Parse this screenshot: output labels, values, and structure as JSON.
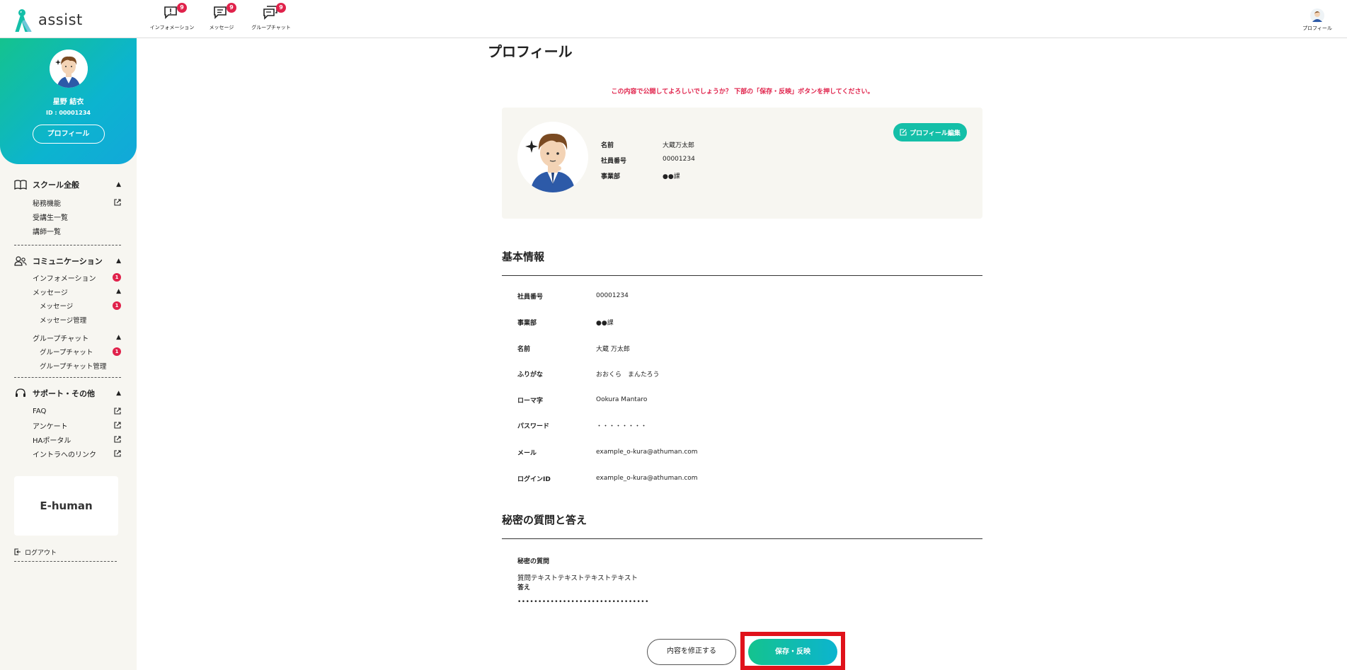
{
  "header": {
    "logo_text": "assist",
    "nav": [
      {
        "label": "インフォメーション",
        "badge": "9",
        "icon": "info-bubble-icon"
      },
      {
        "label": "メッセージ",
        "badge": "9",
        "icon": "message-bubble-icon"
      },
      {
        "label": "グループチャット",
        "badge": "9",
        "icon": "group-chat-icon"
      }
    ],
    "profile_label": "プロフィール"
  },
  "sidebar": {
    "user_name": "星野 結衣",
    "user_id": "ID : 00001234",
    "profile_button": "プロフィール",
    "sections": {
      "school": {
        "title": "スクール全般",
        "items": [
          "秘務機能",
          "受講生一覧",
          "講師一覧"
        ]
      },
      "communication": {
        "title": "コミュニケーション",
        "info": {
          "label": "インフォメーション",
          "badge": "1"
        },
        "message_group": "メッセージ",
        "message": {
          "label": "メッセージ",
          "badge": "1"
        },
        "message_manage": "メッセージ管理",
        "group_chat_group": "グループチャット",
        "group_chat": {
          "label": "グループチャット",
          "badge": "1"
        },
        "group_chat_manage": "グループチャット管理"
      },
      "support": {
        "title": "サポート・その他",
        "items": [
          "FAQ",
          "アンケート",
          "HAポータル",
          "イントラへのリンク"
        ]
      }
    },
    "banner": "E-human",
    "logout": "ログアウト"
  },
  "main": {
    "title": "プロフィール",
    "notice": "この内容で公開してよろしいでしょうか？ 下部の「保存・反映」ボタンを押してください。",
    "card": {
      "edit_button": "プロフィール編集",
      "rows": [
        {
          "label": "名前",
          "value": "大蔵万太郎"
        },
        {
          "label": "社員番号",
          "value": "00001234"
        },
        {
          "label": "事業部",
          "value": "●●課"
        }
      ]
    },
    "basic_title": "基本情報",
    "basic_rows": [
      {
        "label": "社員番号",
        "value": "00001234"
      },
      {
        "label": "事業部",
        "value": "●●課"
      },
      {
        "label": "名前",
        "value": "大蔵 万太郎"
      },
      {
        "label": "ふりがな",
        "value": "おおくら　まんたろう"
      },
      {
        "label": "ローマ字",
        "value": "Ookura Mantaro"
      },
      {
        "label": "パスワード",
        "value": "・・・・・・・・"
      },
      {
        "label": "メール",
        "value": "example_o-kura@athuman.com"
      },
      {
        "label": "ログインID",
        "value": "example_o-kura@athuman.com"
      }
    ],
    "secret_title": "秘密の質問と答え",
    "secret_q_label": "秘密の質問",
    "secret_q": "質問テキストテキストテキストテキスト",
    "secret_a_label": "答え",
    "secret_a": "••••••••••••••••••••••••••••••••",
    "modify_button": "内容を修正する",
    "save_button": "保存・反映"
  },
  "colors": {
    "accent_green": "#14c38e",
    "accent_blue": "#0cb4cf",
    "badge_red": "#e0224b",
    "highlight_red": "#e0121b"
  }
}
